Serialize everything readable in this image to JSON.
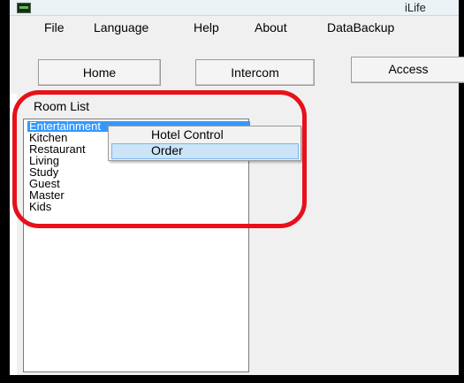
{
  "window": {
    "title": "iLife",
    "icon": "app-icon"
  },
  "menu": {
    "items": [
      "File",
      "Language",
      "Help",
      "About",
      "DataBackup"
    ]
  },
  "nav": {
    "home": "Home",
    "intercom": "Intercom",
    "access": "Access"
  },
  "room_list": {
    "label": "Room List",
    "items": [
      "Entertainment",
      "Kitchen",
      "Restaurant",
      "Living",
      "Study",
      "Guest",
      "Master",
      "Kids"
    ],
    "selected": "Entertainment"
  },
  "context_menu": {
    "items": [
      "Hotel Control",
      "Order"
    ],
    "highlighted": "Order"
  },
  "colors": {
    "selection": "#3399ff",
    "menu_highlight": "#cce4f7",
    "annotation": "#e8101a"
  }
}
